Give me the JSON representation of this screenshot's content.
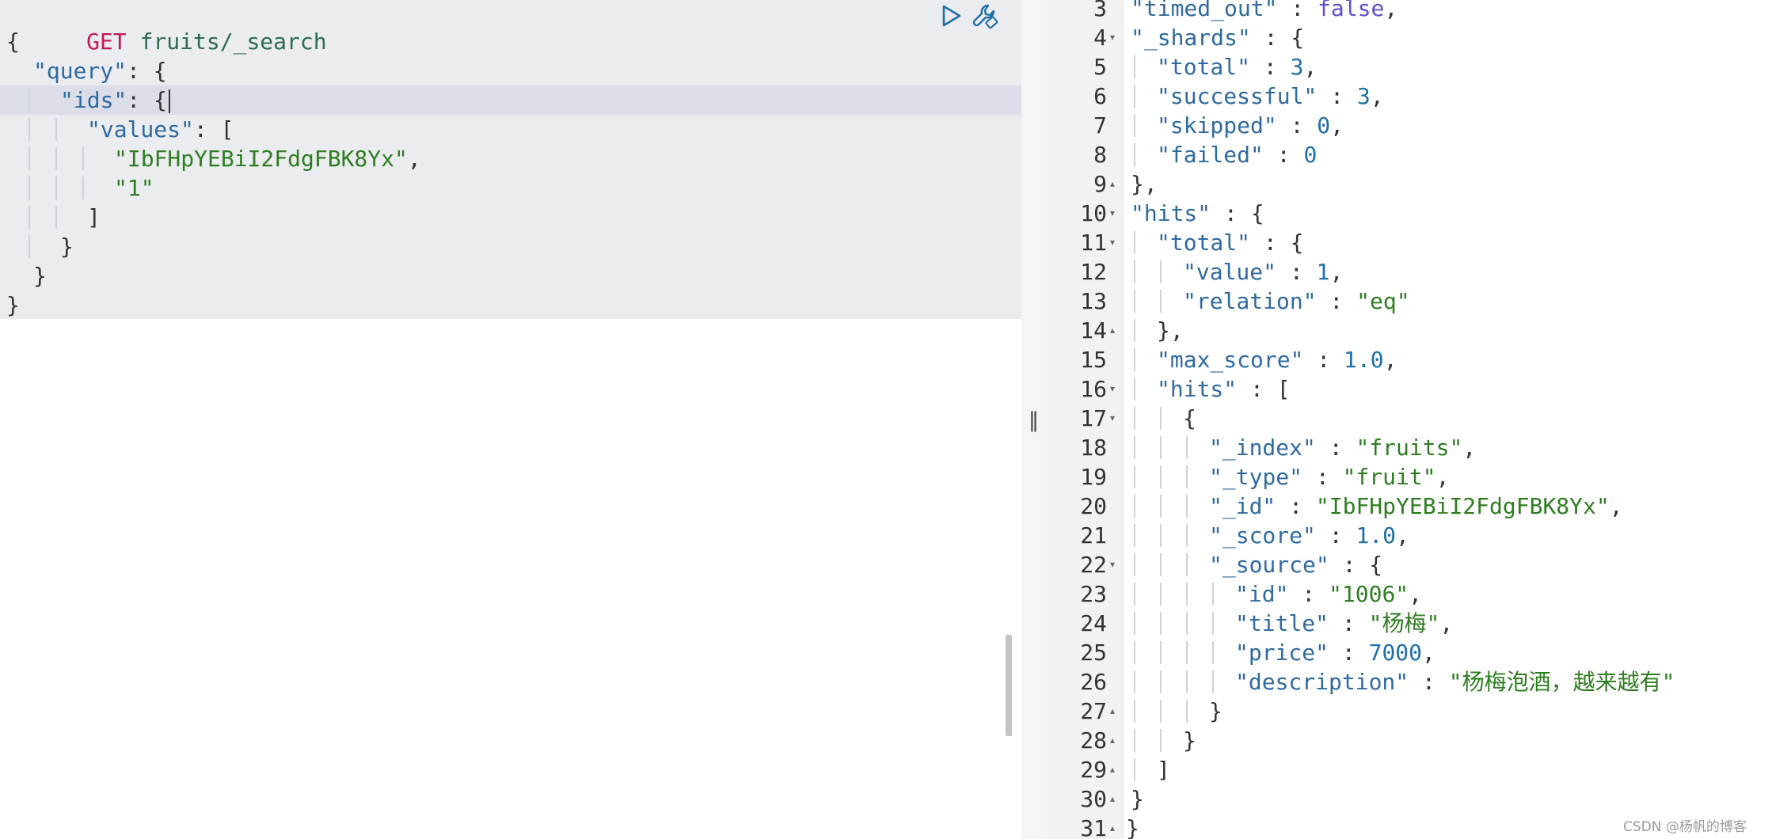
{
  "request": {
    "method": "GET",
    "path": "fruits/_search",
    "lines": [
      {
        "indent": 0,
        "tokens": [
          {
            "t": "p",
            "v": "{"
          }
        ]
      },
      {
        "indent": 1,
        "tokens": [
          {
            "t": "key",
            "v": "\"query\""
          },
          {
            "t": "p",
            "v": ": {"
          }
        ]
      },
      {
        "indent": 2,
        "tokens": [
          {
            "t": "key",
            "v": "\"ids\""
          },
          {
            "t": "p",
            "v": ": {"
          }
        ],
        "cursor": true
      },
      {
        "indent": 3,
        "tokens": [
          {
            "t": "key",
            "v": "\"values\""
          },
          {
            "t": "p",
            "v": ": ["
          }
        ]
      },
      {
        "indent": 4,
        "tokens": [
          {
            "t": "str",
            "v": "\"IbFHpYEBiI2FdgFBK8Yx\""
          },
          {
            "t": "p",
            "v": ","
          }
        ]
      },
      {
        "indent": 4,
        "tokens": [
          {
            "t": "str",
            "v": "\"1\""
          }
        ]
      },
      {
        "indent": 3,
        "tokens": [
          {
            "t": "p",
            "v": "]"
          }
        ]
      },
      {
        "indent": 2,
        "tokens": [
          {
            "t": "p",
            "v": "}"
          }
        ]
      },
      {
        "indent": 1,
        "tokens": [
          {
            "t": "p",
            "v": "}"
          }
        ]
      },
      {
        "indent": 0,
        "tokens": [
          {
            "t": "p",
            "v": "}"
          }
        ]
      }
    ]
  },
  "toolbar": {
    "run_icon": "play-icon",
    "settings_icon": "wrench-icon"
  },
  "splitter": {
    "handle_glyph": "‖"
  },
  "response": {
    "lines": [
      {
        "num": "3",
        "fold": "",
        "indent": 1,
        "tokens": [
          {
            "t": "key",
            "v": "\"timed_out\""
          },
          {
            "t": "p",
            "v": " : "
          },
          {
            "t": "kw",
            "v": "false"
          },
          {
            "t": "p",
            "v": ","
          }
        ]
      },
      {
        "num": "4",
        "fold": "▾",
        "indent": 1,
        "tokens": [
          {
            "t": "key",
            "v": "\"_shards\""
          },
          {
            "t": "p",
            "v": " : {"
          }
        ]
      },
      {
        "num": "5",
        "fold": "",
        "indent": 2,
        "tokens": [
          {
            "t": "key",
            "v": "\"total\""
          },
          {
            "t": "p",
            "v": " : "
          },
          {
            "t": "num",
            "v": "3"
          },
          {
            "t": "p",
            "v": ","
          }
        ]
      },
      {
        "num": "6",
        "fold": "",
        "indent": 2,
        "tokens": [
          {
            "t": "key",
            "v": "\"successful\""
          },
          {
            "t": "p",
            "v": " : "
          },
          {
            "t": "num",
            "v": "3"
          },
          {
            "t": "p",
            "v": ","
          }
        ]
      },
      {
        "num": "7",
        "fold": "",
        "indent": 2,
        "tokens": [
          {
            "t": "key",
            "v": "\"skipped\""
          },
          {
            "t": "p",
            "v": " : "
          },
          {
            "t": "num",
            "v": "0"
          },
          {
            "t": "p",
            "v": ","
          }
        ]
      },
      {
        "num": "8",
        "fold": "",
        "indent": 2,
        "tokens": [
          {
            "t": "key",
            "v": "\"failed\""
          },
          {
            "t": "p",
            "v": " : "
          },
          {
            "t": "num",
            "v": "0"
          }
        ]
      },
      {
        "num": "9",
        "fold": "▴",
        "indent": 1,
        "tokens": [
          {
            "t": "p",
            "v": "},"
          }
        ]
      },
      {
        "num": "10",
        "fold": "▾",
        "indent": 1,
        "tokens": [
          {
            "t": "key",
            "v": "\"hits\""
          },
          {
            "t": "p",
            "v": " : {"
          }
        ]
      },
      {
        "num": "11",
        "fold": "▾",
        "indent": 2,
        "tokens": [
          {
            "t": "key",
            "v": "\"total\""
          },
          {
            "t": "p",
            "v": " : {"
          }
        ]
      },
      {
        "num": "12",
        "fold": "",
        "indent": 3,
        "tokens": [
          {
            "t": "key",
            "v": "\"value\""
          },
          {
            "t": "p",
            "v": " : "
          },
          {
            "t": "num",
            "v": "1"
          },
          {
            "t": "p",
            "v": ","
          }
        ]
      },
      {
        "num": "13",
        "fold": "",
        "indent": 3,
        "tokens": [
          {
            "t": "key",
            "v": "\"relation\""
          },
          {
            "t": "p",
            "v": " : "
          },
          {
            "t": "str",
            "v": "\"eq\""
          }
        ]
      },
      {
        "num": "14",
        "fold": "▴",
        "indent": 2,
        "tokens": [
          {
            "t": "p",
            "v": "},"
          }
        ]
      },
      {
        "num": "15",
        "fold": "",
        "indent": 2,
        "tokens": [
          {
            "t": "key",
            "v": "\"max_score\""
          },
          {
            "t": "p",
            "v": " : "
          },
          {
            "t": "num",
            "v": "1.0"
          },
          {
            "t": "p",
            "v": ","
          }
        ]
      },
      {
        "num": "16",
        "fold": "▾",
        "indent": 2,
        "tokens": [
          {
            "t": "key",
            "v": "\"hits\""
          },
          {
            "t": "p",
            "v": " : ["
          }
        ]
      },
      {
        "num": "17",
        "fold": "▾",
        "indent": 3,
        "tokens": [
          {
            "t": "p",
            "v": "{"
          }
        ]
      },
      {
        "num": "18",
        "fold": "",
        "indent": 4,
        "tokens": [
          {
            "t": "key",
            "v": "\"_index\""
          },
          {
            "t": "p",
            "v": " : "
          },
          {
            "t": "str",
            "v": "\"fruits\""
          },
          {
            "t": "p",
            "v": ","
          }
        ]
      },
      {
        "num": "19",
        "fold": "",
        "indent": 4,
        "tokens": [
          {
            "t": "key",
            "v": "\"_type\""
          },
          {
            "t": "p",
            "v": " : "
          },
          {
            "t": "str",
            "v": "\"fruit\""
          },
          {
            "t": "p",
            "v": ","
          }
        ]
      },
      {
        "num": "20",
        "fold": "",
        "indent": 4,
        "tokens": [
          {
            "t": "key",
            "v": "\"_id\""
          },
          {
            "t": "p",
            "v": " : "
          },
          {
            "t": "str",
            "v": "\"IbFHpYEBiI2FdgFBK8Yx\""
          },
          {
            "t": "p",
            "v": ","
          }
        ]
      },
      {
        "num": "21",
        "fold": "",
        "indent": 4,
        "tokens": [
          {
            "t": "key",
            "v": "\"_score\""
          },
          {
            "t": "p",
            "v": " : "
          },
          {
            "t": "num",
            "v": "1.0"
          },
          {
            "t": "p",
            "v": ","
          }
        ]
      },
      {
        "num": "22",
        "fold": "▾",
        "indent": 4,
        "tokens": [
          {
            "t": "key",
            "v": "\"_source\""
          },
          {
            "t": "p",
            "v": " : {"
          }
        ]
      },
      {
        "num": "23",
        "fold": "",
        "indent": 5,
        "tokens": [
          {
            "t": "key",
            "v": "\"id\""
          },
          {
            "t": "p",
            "v": " : "
          },
          {
            "t": "str",
            "v": "\"1006\""
          },
          {
            "t": "p",
            "v": ","
          }
        ]
      },
      {
        "num": "24",
        "fold": "",
        "indent": 5,
        "tokens": [
          {
            "t": "key",
            "v": "\"title\""
          },
          {
            "t": "p",
            "v": " : "
          },
          {
            "t": "str",
            "v": "\"杨梅\""
          },
          {
            "t": "p",
            "v": ","
          }
        ]
      },
      {
        "num": "25",
        "fold": "",
        "indent": 5,
        "tokens": [
          {
            "t": "key",
            "v": "\"price\""
          },
          {
            "t": "p",
            "v": " : "
          },
          {
            "t": "num",
            "v": "7000"
          },
          {
            "t": "p",
            "v": ","
          }
        ]
      },
      {
        "num": "26",
        "fold": "",
        "indent": 5,
        "tokens": [
          {
            "t": "key",
            "v": "\"description\""
          },
          {
            "t": "p",
            "v": " : "
          },
          {
            "t": "str",
            "v": "\"杨梅泡酒，越来越有\""
          }
        ]
      },
      {
        "num": "27",
        "fold": "▴",
        "indent": 4,
        "tokens": [
          {
            "t": "p",
            "v": "}"
          }
        ]
      },
      {
        "num": "28",
        "fold": "▴",
        "indent": 3,
        "tokens": [
          {
            "t": "p",
            "v": "}"
          }
        ]
      },
      {
        "num": "29",
        "fold": "▴",
        "indent": 2,
        "tokens": [
          {
            "t": "p",
            "v": "]"
          }
        ]
      },
      {
        "num": "30",
        "fold": "▴",
        "indent": 1,
        "tokens": [
          {
            "t": "p",
            "v": "}"
          }
        ]
      },
      {
        "num": "31",
        "fold": "▴",
        "indent": 0,
        "tokens": [
          {
            "t": "p",
            "v": "}"
          }
        ]
      }
    ]
  },
  "watermark": "CSDN @杨帆的博客",
  "colors": {
    "method": "#c2185b",
    "url": "#2e6b52",
    "key": "#2f6aa0",
    "string": "#2e7d20",
    "number": "#1f6fa8",
    "keyword": "#5b4fd0",
    "request_bg": "#eaecf0",
    "active_line_bg": "#dbdee8",
    "gutter_bg": "#f2f2f2",
    "icon": "#1f6fa8"
  }
}
